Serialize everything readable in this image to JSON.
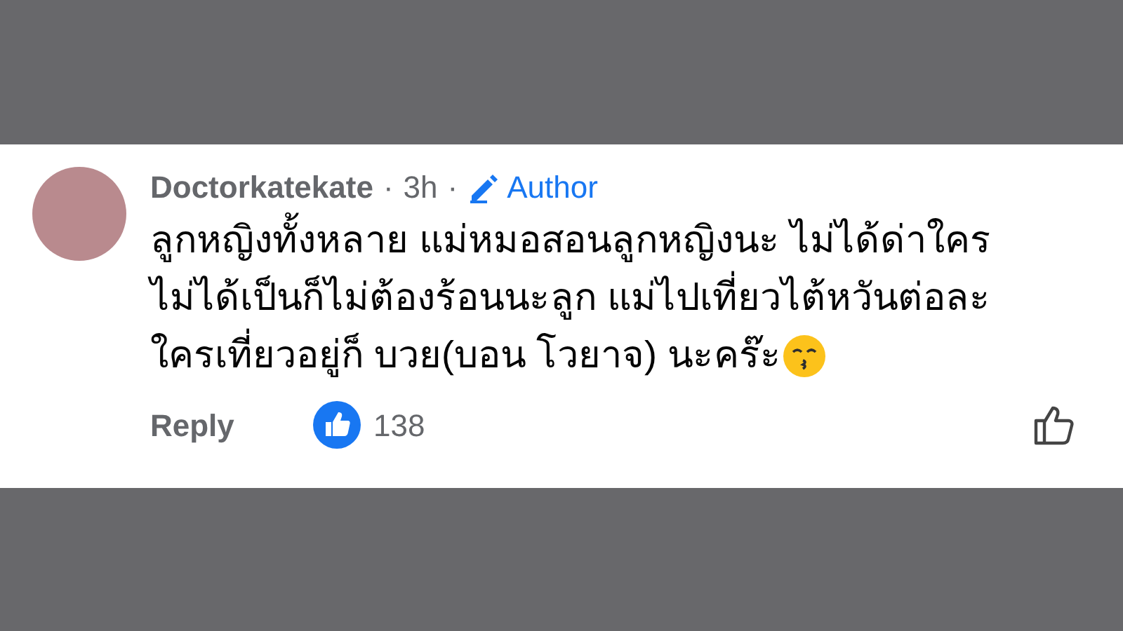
{
  "comment": {
    "author": "Doctorkatekate",
    "separator_1": "·",
    "time": "3h",
    "separator_2": "·",
    "badge": "Author",
    "lines": [
      "ลูกหญิงทั้งหลาย แม่หมอสอนลูกหญิงนะ ไม่ได้ด่าใคร",
      "ไม่ได้เป็นก็ไม่ต้องร้อนนะลูก แม่ไปเที่ยวไต้หวันต่อละ",
      "ใครเที่ยวอยู่ก็ บวย(บอน โวยาจ) นะคร๊ะ"
    ],
    "reply": "Reply",
    "reactions": "138"
  }
}
